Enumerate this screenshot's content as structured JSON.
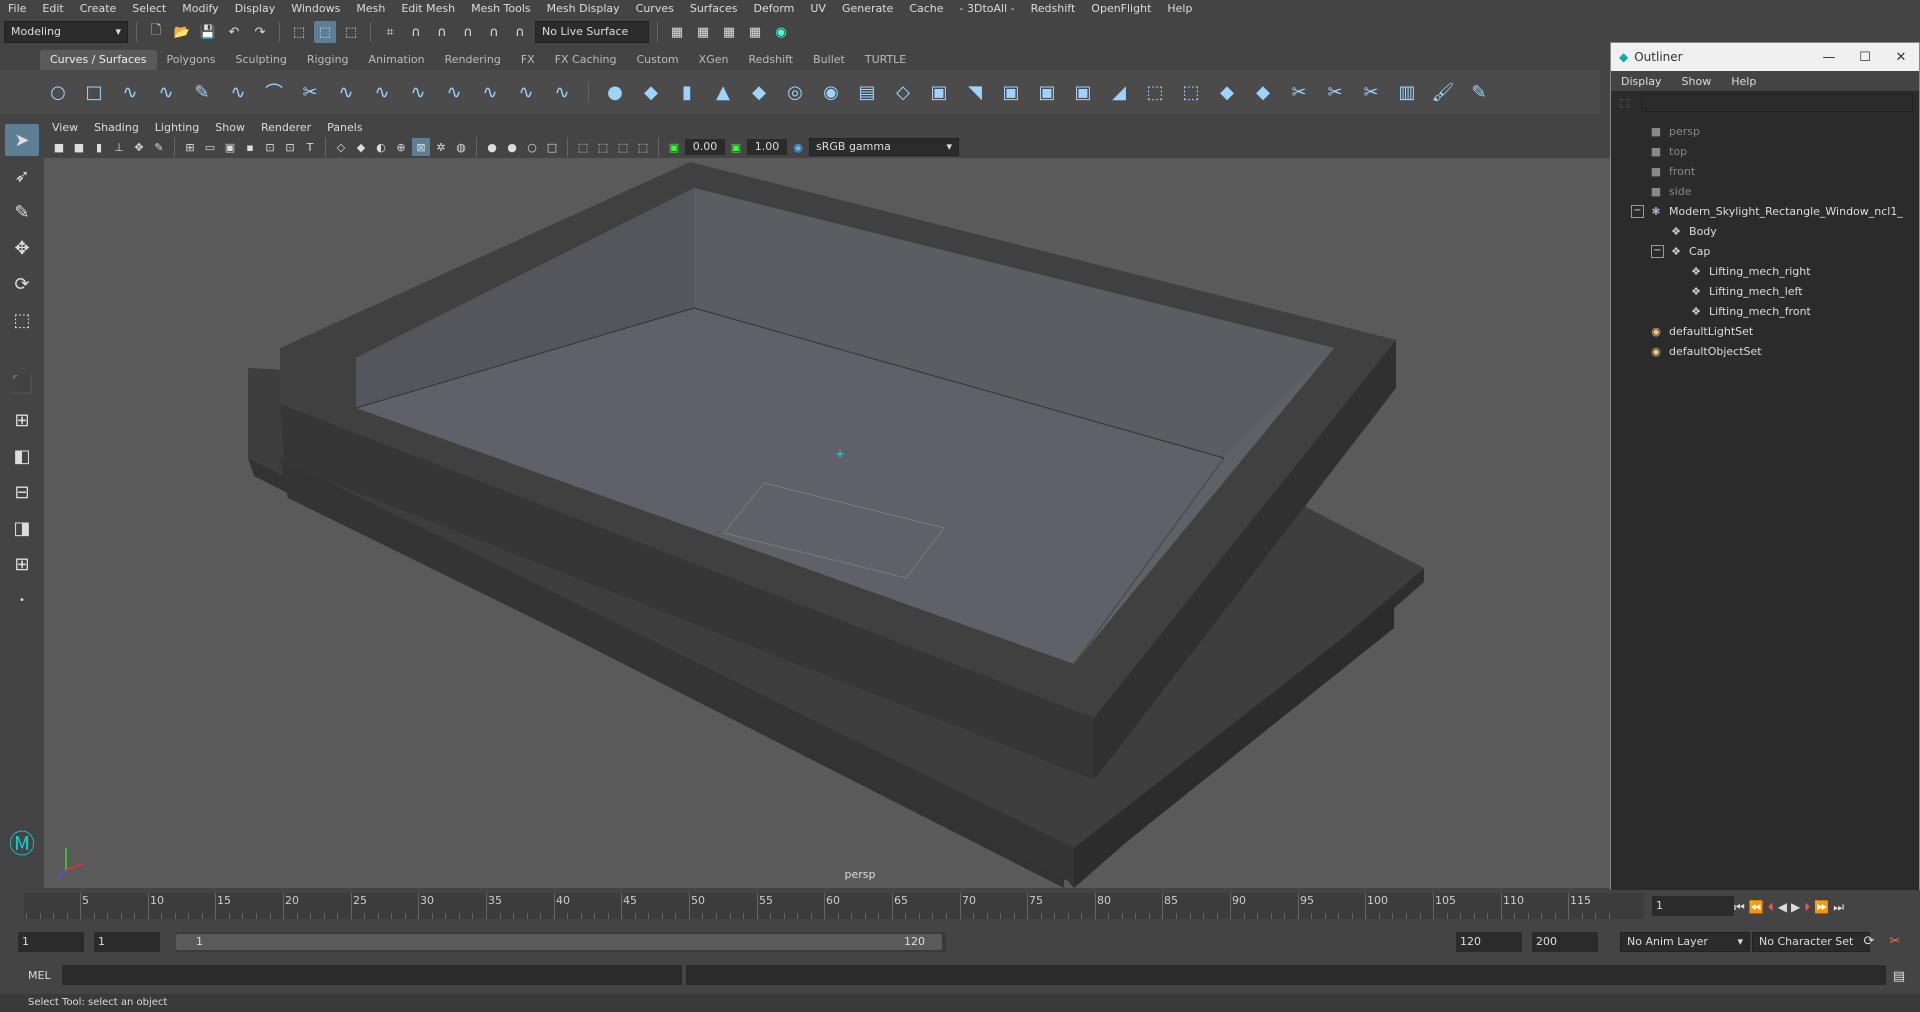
{
  "menubar": [
    "File",
    "Edit",
    "Create",
    "Select",
    "Modify",
    "Display",
    "Windows",
    "Mesh",
    "Edit Mesh",
    "Mesh Tools",
    "Mesh Display",
    "Curves",
    "Surfaces",
    "Deform",
    "UV",
    "Generate",
    "Cache",
    "- 3DtoAll -",
    "Redshift",
    "OpenFlight",
    "Help"
  ],
  "statusline": {
    "mode": "Modeling",
    "live_surface": "No Live Surface"
  },
  "shelf_tabs": [
    "Curves / Surfaces",
    "Polygons",
    "Sculpting",
    "Rigging",
    "Animation",
    "Rendering",
    "FX",
    "FX Caching",
    "Custom",
    "XGen",
    "Redshift",
    "Bullet",
    "TURTLE"
  ],
  "shelf_active": "Curves / Surfaces",
  "panel_menu": [
    "View",
    "Shading",
    "Lighting",
    "Show",
    "Renderer",
    "Panels"
  ],
  "panel_toolbar": {
    "exposure": "0.00",
    "gamma": "1.00",
    "color_space": "sRGB gamma"
  },
  "viewport": {
    "camera_label": "persp"
  },
  "outliner": {
    "title": "Outliner",
    "menu": [
      "Display",
      "Show",
      "Help"
    ],
    "items": [
      {
        "label": "persp",
        "indent": 0,
        "icon": "camera-icon",
        "dim": true
      },
      {
        "label": "top",
        "indent": 0,
        "icon": "camera-icon",
        "dim": true
      },
      {
        "label": "front",
        "indent": 0,
        "icon": "camera-icon",
        "dim": true
      },
      {
        "label": "side",
        "indent": 0,
        "icon": "camera-icon",
        "dim": true
      },
      {
        "label": "Modern_Skylight_Rectangle_Window_ncl1_",
        "indent": 0,
        "icon": "group-icon",
        "dim": false,
        "expander": "−"
      },
      {
        "label": "Body",
        "indent": 1,
        "icon": "mesh-icon",
        "dim": false
      },
      {
        "label": "Cap",
        "indent": 1,
        "icon": "mesh-icon",
        "dim": false,
        "expander": "−"
      },
      {
        "label": "Lifting_mech_right",
        "indent": 2,
        "icon": "mesh-icon",
        "dim": false
      },
      {
        "label": "Lifting_mech_left",
        "indent": 2,
        "icon": "mesh-icon",
        "dim": false
      },
      {
        "label": "Lifting_mech_front",
        "indent": 2,
        "icon": "mesh-icon",
        "dim": false
      },
      {
        "label": "defaultLightSet",
        "indent": 0,
        "icon": "set-icon",
        "dim": false
      },
      {
        "label": "defaultObjectSet",
        "indent": 0,
        "icon": "set-icon",
        "dim": false
      }
    ]
  },
  "timeline": {
    "ticks": [
      "5",
      "10",
      "15",
      "20",
      "25",
      "30",
      "35",
      "40",
      "45",
      "50",
      "55",
      "60",
      "65",
      "70",
      "75",
      "80",
      "85",
      "90",
      "95",
      "100",
      "105",
      "110",
      "115"
    ],
    "start_frame_label": "1",
    "current_frame": "1"
  },
  "range": {
    "start": "1",
    "playback_start": "1",
    "range_start": "1",
    "range_end": "120",
    "playback_end": "120",
    "end": "200",
    "anim_layer": "No Anim Layer",
    "character_set": "No Character Set"
  },
  "cmdline": {
    "lang": "MEL"
  },
  "help_line": "Select Tool: select an object"
}
